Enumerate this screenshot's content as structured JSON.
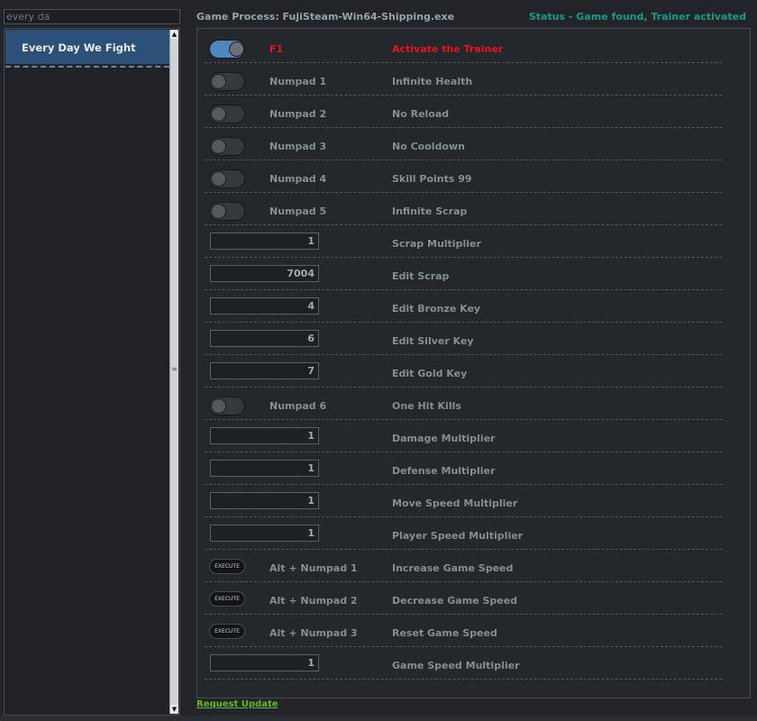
{
  "search": {
    "value": "every da"
  },
  "game_list": {
    "items": [
      {
        "label": "Every Day We Fight",
        "selected": true
      }
    ]
  },
  "header": {
    "process": "Game Process: FujiSteam-Win64-Shipping.exe",
    "status": "Status - Game found, Trainer activated"
  },
  "colors": {
    "accent": "#4e86bd",
    "status": "#169a8c",
    "active": "#e3141b",
    "link": "#63b81e",
    "selected_item": "#2c5077"
  },
  "icons": {
    "scroll_up": "arrow-up-icon",
    "scroll_down": "arrow-down-icon",
    "scroll_grip": "grip-icon"
  },
  "cheats": [
    {
      "type": "toggle",
      "on": true,
      "hotkey": "F1",
      "label": "Activate the Trainer",
      "active": true
    },
    {
      "type": "toggle",
      "on": false,
      "hotkey": "Numpad 1",
      "label": "Infinite Health"
    },
    {
      "type": "toggle",
      "on": false,
      "hotkey": "Numpad 2",
      "label": "No Reload"
    },
    {
      "type": "toggle",
      "on": false,
      "hotkey": "Numpad 3",
      "label": "No Cooldown"
    },
    {
      "type": "toggle",
      "on": false,
      "hotkey": "Numpad 4",
      "label": "Skill Points 99"
    },
    {
      "type": "toggle",
      "on": false,
      "hotkey": "Numpad 5",
      "label": "Infinite Scrap"
    },
    {
      "type": "input",
      "value": "1",
      "label": "Scrap Multiplier"
    },
    {
      "type": "input",
      "value": "7004",
      "label": "Edit Scrap"
    },
    {
      "type": "input",
      "value": "4",
      "label": "Edit Bronze Key"
    },
    {
      "type": "input",
      "value": "6",
      "label": "Edit Silver Key"
    },
    {
      "type": "input",
      "value": "7",
      "label": "Edit Gold Key"
    },
    {
      "type": "toggle",
      "on": false,
      "hotkey": "Numpad 6",
      "label": "One Hit Kills"
    },
    {
      "type": "input",
      "value": "1",
      "label": "Damage Multiplier"
    },
    {
      "type": "input",
      "value": "1",
      "label": "Defense Multiplier"
    },
    {
      "type": "input",
      "value": "1",
      "label": "Move Speed Multiplier"
    },
    {
      "type": "input",
      "value": "1",
      "label": "Player Speed Multiplier"
    },
    {
      "type": "execute",
      "button": "EXECUTE",
      "hotkey": "Alt + Numpad 1",
      "label": "Increase Game Speed"
    },
    {
      "type": "execute",
      "button": "EXECUTE",
      "hotkey": "Alt + Numpad 2",
      "label": "Decrease Game Speed"
    },
    {
      "type": "execute",
      "button": "EXECUTE",
      "hotkey": "Alt + Numpad 3",
      "label": "Reset Game Speed"
    },
    {
      "type": "input",
      "value": "1",
      "label": "Game Speed Multiplier"
    }
  ],
  "footer": {
    "link": "Request Update"
  }
}
